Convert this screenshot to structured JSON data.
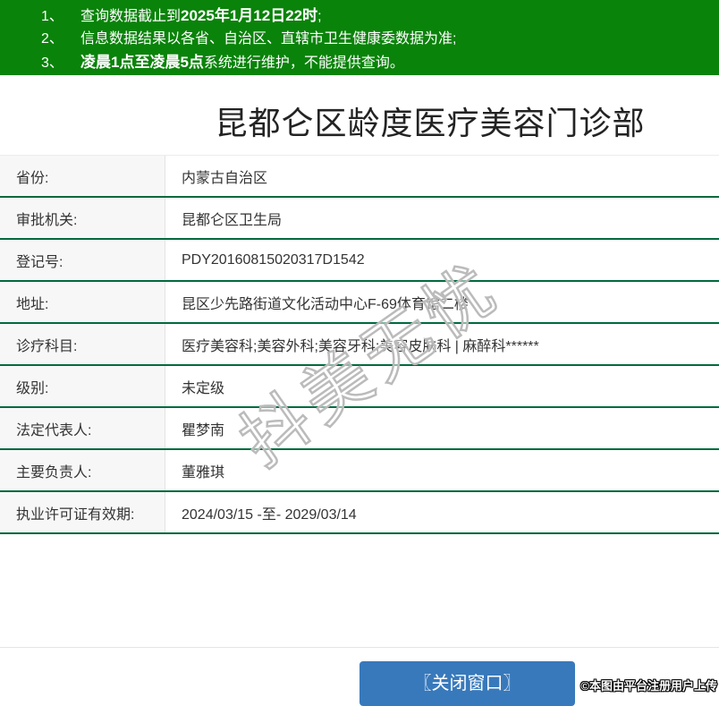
{
  "header": {
    "bg_color": "#0a830a",
    "notices": [
      {
        "num": "1、",
        "parts": [
          {
            "text": "查询数据截止到"
          },
          {
            "text": "2025年1月12日22时",
            "bold": true
          },
          {
            "text": ";"
          }
        ]
      },
      {
        "num": "2、",
        "parts": [
          {
            "text": "信息数据结果以各省、自治区、直辖市卫生健康委数据为准;"
          }
        ]
      },
      {
        "num": "3、",
        "parts": [
          {
            "text": "凌晨1点至凌晨5点",
            "bold": true
          },
          {
            "text": "系统进行维护，不能提供查询。"
          }
        ]
      }
    ]
  },
  "title": "昆都仑区龄度医疗美容门诊部",
  "table": {
    "line_color": "#006a3d",
    "label_bg_color": "#f7f7f7",
    "rows": [
      {
        "label": "省份:",
        "value": "内蒙古自治区"
      },
      {
        "label": "审批机关:",
        "value": "昆都仑区卫生局"
      },
      {
        "label": "登记号:",
        "value": "PDY20160815020317D1542"
      },
      {
        "label": "地址:",
        "value": "昆区少先路街道文化活动中心F-69体育馆二楼"
      },
      {
        "label": "诊疗科目:",
        "value": "医疗美容科;美容外科;美容牙科;美容皮肤科 | 麻醉科******"
      },
      {
        "label": "级别:",
        "value": "未定级"
      },
      {
        "label": "法定代表人:",
        "value": "瞿梦南"
      },
      {
        "label": "主要负责人:",
        "value": "董雅琪"
      },
      {
        "label": "执业许可证有效期:",
        "value": "2024/03/15 -至- 2029/03/14"
      }
    ]
  },
  "watermark": {
    "text": "抖美无忧"
  },
  "footer": {
    "close_button_label": "〖关闭窗口〗",
    "button_color": "#3879bb",
    "copyright": "©本图由平台注册用户上传"
  }
}
